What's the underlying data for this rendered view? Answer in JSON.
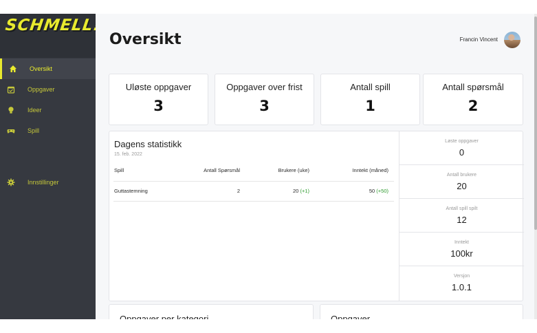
{
  "sidebar": {
    "logo": "SCHMELL!",
    "items": [
      {
        "label": "Oversikt",
        "icon": "home-icon"
      },
      {
        "label": "Oppgaver",
        "icon": "calendar-check-icon"
      },
      {
        "label": "Ideer",
        "icon": "lightbulb-icon"
      },
      {
        "label": "Spill",
        "icon": "gamepad-icon"
      },
      {
        "label": "Innstillinger",
        "icon": "gear-icon"
      }
    ]
  },
  "header": {
    "title": "Oversikt",
    "user_name": "Francin Vincent"
  },
  "stats": [
    {
      "label": "Uløste oppgaver",
      "value": "3"
    },
    {
      "label": "Oppgaver over frist",
      "value": "3"
    },
    {
      "label": "Antall spill",
      "value": "1"
    },
    {
      "label": "Antall spørsmål",
      "value": "2"
    }
  ],
  "daily": {
    "title": "Dagens statistikk",
    "date": "15. feb. 2022",
    "columns": [
      "Spill",
      "Antall Spørsmål",
      "Brukere (uke)",
      "Inntekt (måned)"
    ],
    "rows": [
      {
        "spill": "Guttastemning",
        "antall": "2",
        "brukere": "20",
        "brukere_delta": "(+1)",
        "inntekt": "50",
        "inntekt_delta": "(+50)"
      }
    ]
  },
  "side_stats": [
    {
      "label": "Løste oppgaver",
      "value": "0"
    },
    {
      "label": "Antall brukere",
      "value": "20"
    },
    {
      "label": "Antall spill spilt",
      "value": "12"
    },
    {
      "label": "Inntekt",
      "value": "100kr"
    },
    {
      "label": "Versjon",
      "value": "1.0.1"
    }
  ],
  "bottom": {
    "left_title": "Oppgaver per kategori",
    "right_title": "Oppgaver"
  },
  "colors": {
    "accent": "#e8ea2e",
    "sidebar_bg": "#363940",
    "positive": "#2c9a2c"
  }
}
